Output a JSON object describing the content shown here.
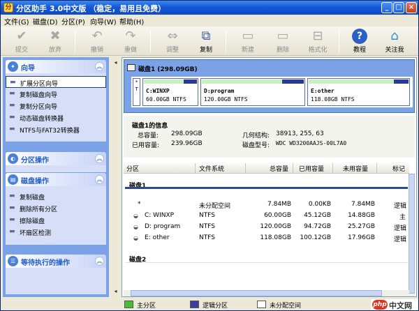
{
  "window": {
    "title": "分区助手 3.0中文版 （稳定，易用且免费）"
  },
  "menu": [
    "文件(G)",
    "磁盘(D)",
    "分区(P)",
    "向导(W)",
    "帮助(H)"
  ],
  "toolbar": {
    "submit": "提交",
    "discard": "放弃",
    "undo": "撤销",
    "redo": "重做",
    "resize": "调整",
    "copy": "复制",
    "create": "新建",
    "delete": "删除",
    "format": "格式化",
    "tutorial": "教程",
    "about": "关注我"
  },
  "sidebar": {
    "wizard": {
      "title": "向导",
      "items": [
        "扩展分区向导",
        "复制磁盘向导",
        "复制分区向导",
        "动态磁盘转换器",
        "NTFS与FAT32转换器"
      ]
    },
    "partition_ops": {
      "title": "分区操作"
    },
    "disk_ops": {
      "title": "磁盘操作",
      "items": [
        "复制磁盘",
        "删除所有分区",
        "擦除磁盘",
        "坏扇区检测"
      ]
    },
    "pending": {
      "title": "等待执行的操作"
    }
  },
  "disk_map": {
    "header": "磁盘1 (298.09GB)",
    "unalloc_label": "*",
    "unalloc_sub": "T",
    "partitions": [
      {
        "name": "C:WINXP",
        "info": "60.00GB NTFS",
        "fill": 0.75
      },
      {
        "name": "D:program",
        "info": "120.00GB NTFS",
        "fill": 0.79
      },
      {
        "name": "E:other",
        "info": "118.08GB NTFS",
        "fill": 0.85
      }
    ]
  },
  "disk_info": {
    "title": "磁盘1的信息",
    "total_label": "总容量:",
    "total": "298.09GB",
    "used_label": "已用容量:",
    "used": "239.96GB",
    "geometry_label": "几何结构:",
    "geometry": "38913, 255, 63",
    "model_label": "磁盘型号:",
    "model": "WDC WD3200AAJS-00L7A0"
  },
  "table": {
    "columns": [
      "分区",
      "文件系统",
      "总容量",
      "已用容量",
      "未用容量",
      "标记"
    ],
    "group1": "磁盘1",
    "group2": "磁盘2",
    "rows": [
      {
        "name": "*",
        "fs": "未分配空间",
        "total": "7.84MB",
        "used": "0.00KB",
        "free": "7.84MB",
        "flag": "逻辑"
      },
      {
        "name": "C: WINXP",
        "fs": "NTFS",
        "total": "60.00GB",
        "used": "45.12GB",
        "free": "14.88GB",
        "flag": "主"
      },
      {
        "name": "D: program",
        "fs": "NTFS",
        "total": "120.00GB",
        "used": "94.72GB",
        "free": "25.27GB",
        "flag": "逻辑"
      },
      {
        "name": "E: other",
        "fs": "NTFS",
        "total": "118.08GB",
        "used": "100.12GB",
        "free": "17.96GB",
        "flag": "逻辑"
      }
    ]
  },
  "legend": {
    "primary": "主分区",
    "logical": "逻辑分区",
    "unallocated": "未分配空间"
  },
  "watermark": {
    "logo": "php",
    "text": "中文网"
  },
  "colors": {
    "primary": "#4cbb3a",
    "logical": "#3b3fa0",
    "unallocated": "#ffffff",
    "accent": "#215dc6"
  }
}
